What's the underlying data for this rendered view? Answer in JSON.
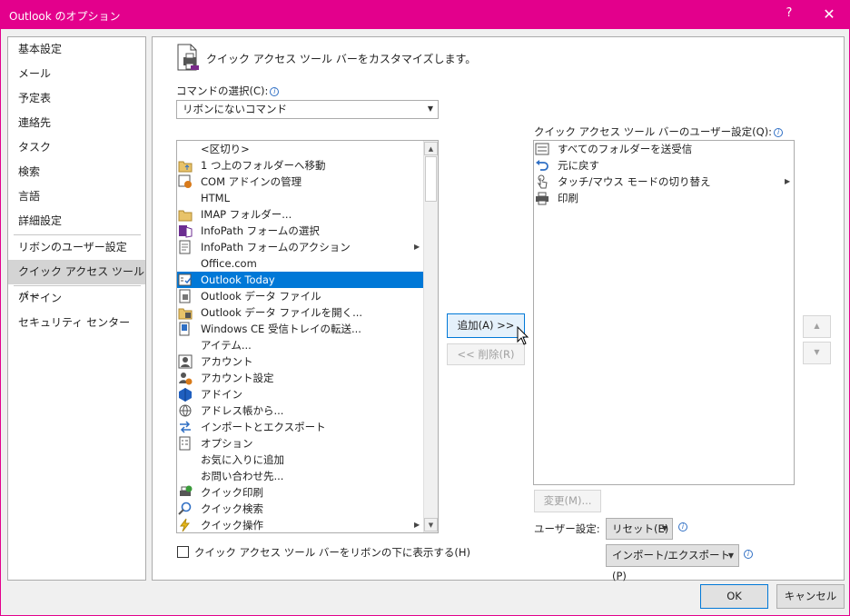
{
  "window": {
    "title": "Outlook のオプション",
    "help": "?",
    "close": "✕"
  },
  "nav": {
    "items": [
      {
        "label": "基本設定"
      },
      {
        "label": "メール"
      },
      {
        "label": "予定表"
      },
      {
        "label": "連絡先"
      },
      {
        "label": "タスク"
      },
      {
        "label": "検索"
      },
      {
        "label": "言語"
      },
      {
        "label": "詳細設定"
      },
      {
        "label": "リボンのユーザー設定"
      },
      {
        "label": "クイック アクセス ツール バー"
      },
      {
        "label": "アドイン"
      },
      {
        "label": "セキュリティ センター"
      }
    ],
    "active_index": 9
  },
  "header": {
    "text": "クイック アクセス ツール バーをカスタマイズします。",
    "icon": "quick-access-toolbar-icon"
  },
  "commands": {
    "label": "コマンドの選択(C):",
    "selected": "リボンにないコマンド",
    "items": [
      {
        "label": "<区切り>",
        "icon": ""
      },
      {
        "label": "1 つ上のフォルダーへ移動",
        "icon": "folder-up-icon"
      },
      {
        "label": "COM アドインの管理",
        "icon": "com-addin-icon"
      },
      {
        "label": "HTML",
        "icon": ""
      },
      {
        "label": "IMAP フォルダー...",
        "icon": "imap-folder-icon"
      },
      {
        "label": "InfoPath フォームの選択",
        "icon": "infopath-icon"
      },
      {
        "label": "InfoPath フォームのアクション",
        "icon": "infopath-action-icon",
        "submenu": true
      },
      {
        "label": "Office.com",
        "icon": ""
      },
      {
        "label": "Outlook Today",
        "icon": "outlook-today-icon",
        "selected": true
      },
      {
        "label": "Outlook データ ファイル",
        "icon": "data-file-icon"
      },
      {
        "label": "Outlook データ ファイルを開く...",
        "icon": "open-data-file-icon"
      },
      {
        "label": "Windows CE 受信トレイの転送...",
        "icon": "inbox-transfer-icon"
      },
      {
        "label": "アイテム...",
        "icon": ""
      },
      {
        "label": "アカウント",
        "icon": "account-icon"
      },
      {
        "label": "アカウント設定",
        "icon": "account-settings-icon"
      },
      {
        "label": "アドイン",
        "icon": "addin-icon"
      },
      {
        "label": "アドレス帳から...",
        "icon": "address-book-icon"
      },
      {
        "label": "インポートとエクスポート",
        "icon": "import-export-icon"
      },
      {
        "label": "オプション",
        "icon": "options-icon"
      },
      {
        "label": "お気に入りに追加",
        "icon": ""
      },
      {
        "label": "お問い合わせ先...",
        "icon": ""
      },
      {
        "label": "クイック印刷",
        "icon": "quick-print-icon"
      },
      {
        "label": "クイック検索",
        "icon": "quick-search-icon"
      },
      {
        "label": "クイック操作",
        "icon": "quick-steps-icon",
        "submenu": true
      }
    ]
  },
  "qat": {
    "label": "クイック アクセス ツール バーのユーザー設定(Q):",
    "items": [
      {
        "label": "すべてのフォルダーを送受信",
        "icon": "send-receive-icon"
      },
      {
        "label": "元に戻す",
        "icon": "undo-icon"
      },
      {
        "label": "タッチ/マウス モードの切り替え",
        "icon": "touch-mouse-icon",
        "submenu": true
      },
      {
        "label": "印刷",
        "icon": "print-icon"
      }
    ]
  },
  "buttons": {
    "add": "追加(A) >>",
    "remove": "<< 削除(R)",
    "modify": "変更(M)...",
    "ok": "OK",
    "cancel": "キャンセル",
    "move_up": "▲",
    "move_down": "▼"
  },
  "customizations": {
    "label": "ユーザー設定:",
    "reset": "リセット(E)",
    "import_export": "インポート/エクスポート(P)"
  },
  "show_below_ribbon": {
    "label": "クイック アクセス ツール バーをリボンの下に表示する(H)",
    "checked": false
  },
  "colors": {
    "accent": "#e3008c",
    "selection": "#0078d7"
  }
}
